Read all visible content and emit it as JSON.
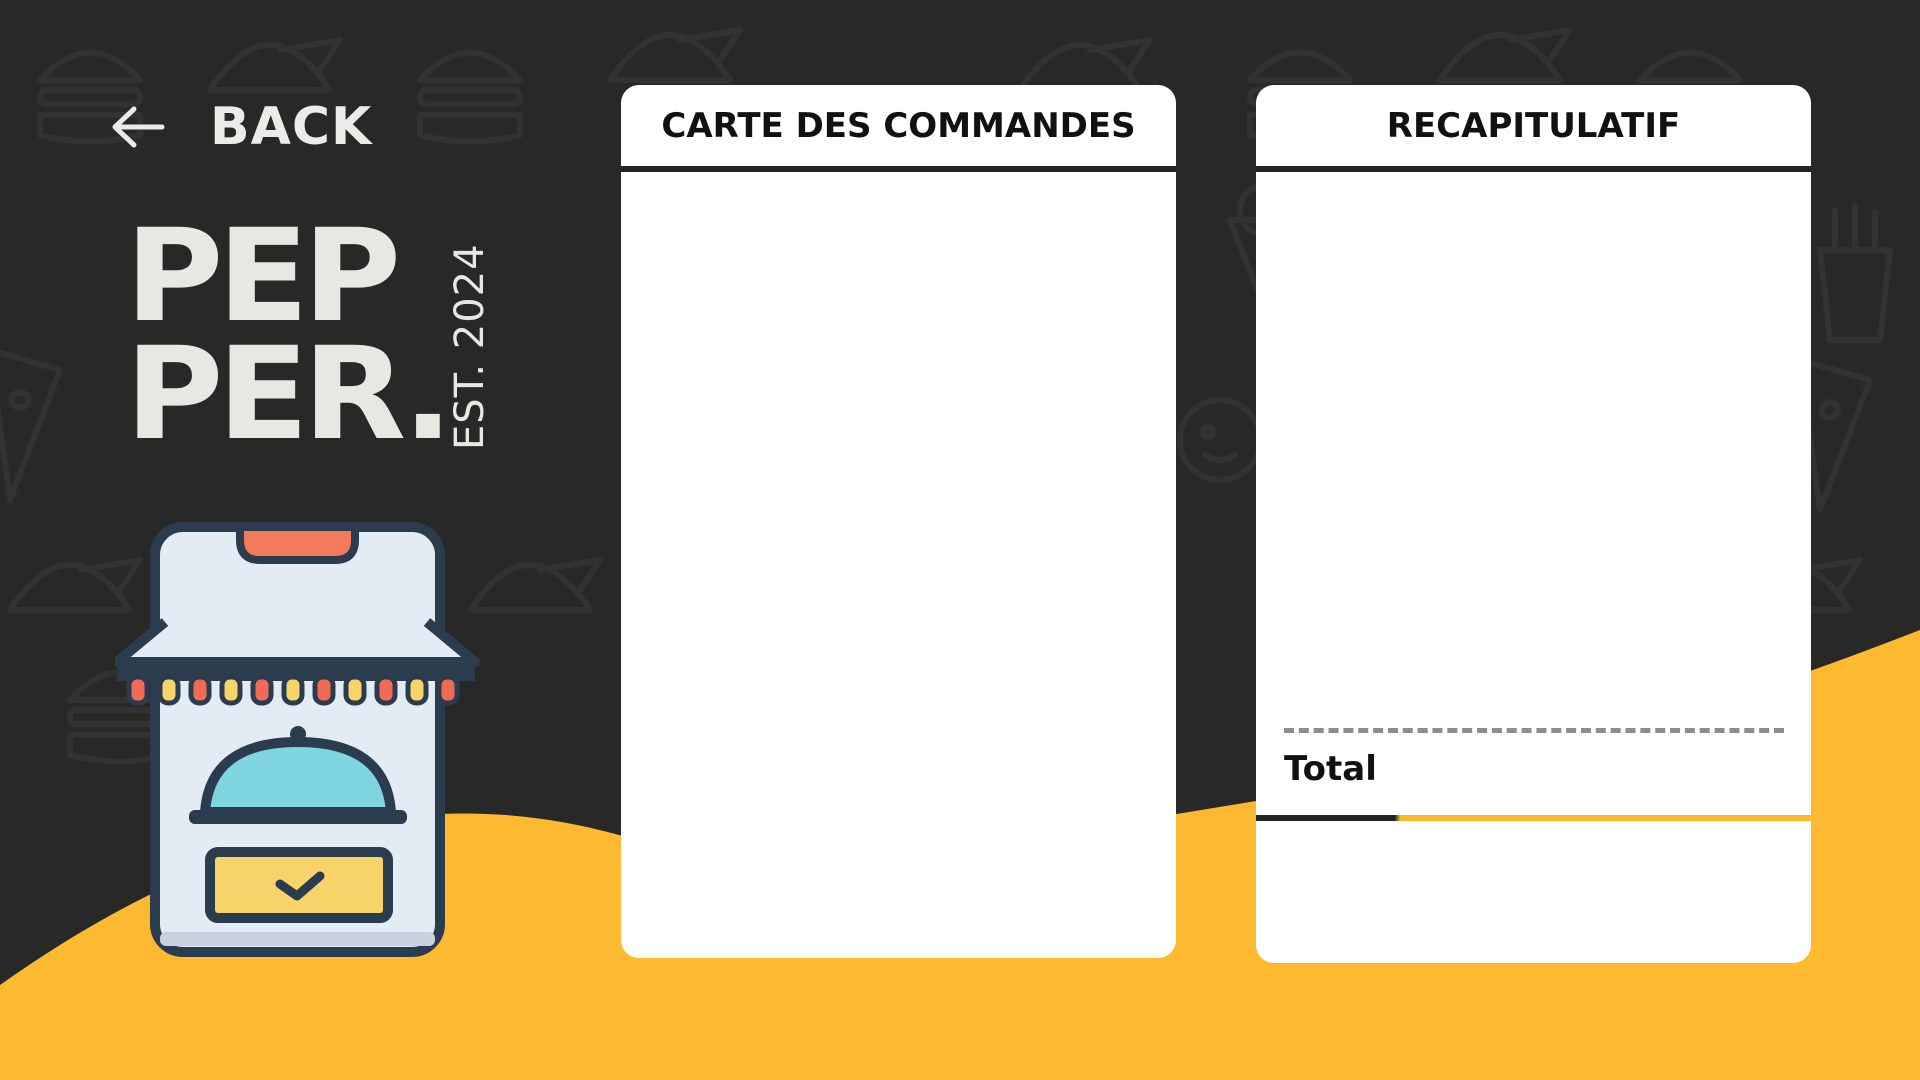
{
  "navigation": {
    "back_label": "BACK"
  },
  "brand": {
    "logo_line_1": "PEP",
    "logo_line_2": "PER.",
    "established": "EST. 2024",
    "logo_color": "#e9e7e1"
  },
  "orders_panel": {
    "title": "CARTE DES COMMANDES",
    "items": []
  },
  "summary_panel": {
    "title": "RECAPITULATIF",
    "items": [],
    "total_label": "Total"
  },
  "colors": {
    "background": "#282828",
    "accent_yellow": "#fdb92f",
    "panel": "#ffffff",
    "text_dark": "#111111"
  },
  "icons": {
    "back": "arrow-left-icon",
    "illustration": "online-food-shop-icon"
  }
}
